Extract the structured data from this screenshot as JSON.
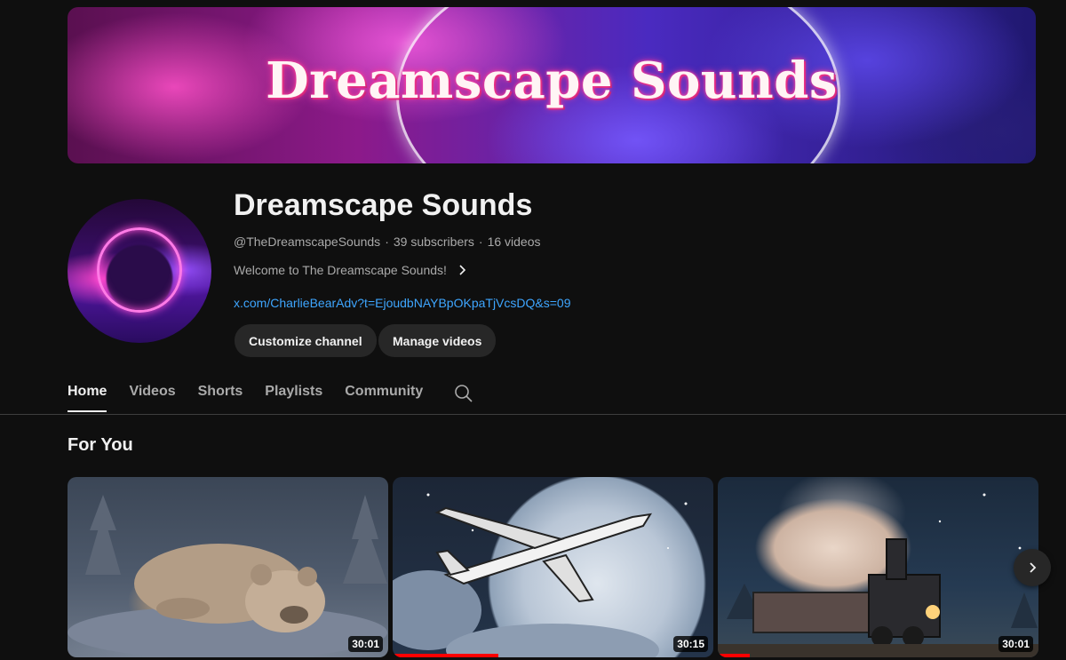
{
  "banner": {
    "title": "Dreamscape Sounds"
  },
  "channel": {
    "name": "Dreamscape Sounds",
    "handle": "@TheDreamscapeSounds",
    "subscribers": "39 subscribers",
    "videos": "16 videos",
    "description": "Welcome to The Dreamscape Sounds!",
    "link": "x.com/CharlieBearAdv?t=EjoudbNAYBpOKpaTjVcsDQ&s=09"
  },
  "buttons": {
    "customize": "Customize channel",
    "manage": "Manage videos"
  },
  "tabs": [
    {
      "label": "Home",
      "active": true
    },
    {
      "label": "Videos",
      "active": false
    },
    {
      "label": "Shorts",
      "active": false
    },
    {
      "label": "Playlists",
      "active": false
    },
    {
      "label": "Community",
      "active": false
    }
  ],
  "section": {
    "title": "For You"
  },
  "videos": [
    {
      "duration": "30:01",
      "subject": "sleeping bear cub",
      "watched_fraction": 0
    },
    {
      "duration": "30:15",
      "subject": "airplane crossing the moon",
      "watched_fraction": 0.33
    },
    {
      "duration": "30:01",
      "subject": "steam train at night",
      "watched_fraction": 0.1
    }
  ],
  "icons": {
    "search": "search-icon",
    "description_chevron": "chevron-right-icon",
    "carousel_next": "chevron-right-icon"
  },
  "colors": {
    "background": "#0f0f0f",
    "link": "#3ea6ff",
    "progress": "#ff0000"
  }
}
